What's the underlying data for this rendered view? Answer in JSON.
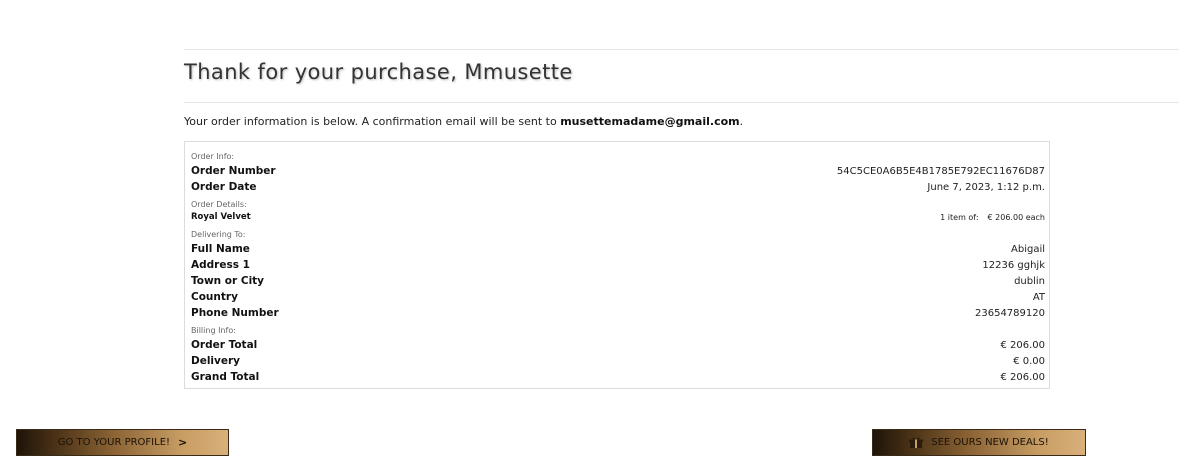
{
  "header": {
    "title": "Thank for your purchase, Mmusette",
    "info_prefix": "Your order information is below. A confirmation email will be sent to",
    "email": "musettemadame@gmail.com",
    "info_suffix": "."
  },
  "order": {
    "order_info_label": "Order Info:",
    "order_number_label": "Order Number",
    "order_number": "54C5CE0A6B5E4B1785E792EC11676D87",
    "order_date_label": "Order Date",
    "order_date": "June 7, 2023, 1:12 p.m.",
    "order_details_label": "Order Details:",
    "item": {
      "name": "Royal Velvet",
      "qty": "1 item of:",
      "price": "€ 206.00 each"
    },
    "delivering_label": "Delivering To:",
    "full_name_label": "Full Name",
    "full_name": "Abigail",
    "address1_label": "Address 1",
    "address1": "12236 gghjk",
    "town_label": "Town or City",
    "town": "dublin",
    "country_label": "Country",
    "country": "AT",
    "phone_label": "Phone Number",
    "phone": "23654789120",
    "billing_label": "Billing Info:",
    "order_total_label": "Order Total",
    "order_total": "€ 206.00",
    "delivery_label": "Delivery",
    "delivery": "€ 0.00",
    "grand_total_label": "Grand Total",
    "grand_total": "€ 206.00"
  },
  "buttons": {
    "profile_label": "GO TO YOUR PROFILE!",
    "profile_icon": "chevron-right-icon",
    "deals_label": "SEE OURS NEW DEALS!",
    "deals_icon": "gift-icon"
  }
}
